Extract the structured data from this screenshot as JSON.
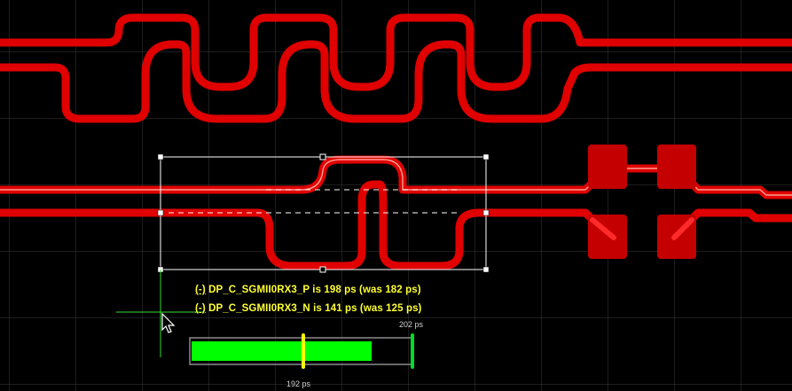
{
  "nets": {
    "p": {
      "prefix": "(-)",
      "text": " DP_C_SGMII0RX3_P is 198 ps (was 182 ps)"
    },
    "n": {
      "prefix": "(-)",
      "text": " DP_C_SGMII0RX3_N is 141 ps (was 125 ps)"
    }
  },
  "gauge": {
    "fill_fraction": 0.86,
    "target_fraction": 0.5,
    "max_label": "202 ps",
    "current_label": "192 ps",
    "colors": {
      "fill": "#00ff00",
      "target": "#ffff00",
      "max_marker": "#00dd22"
    }
  },
  "colors": {
    "trace": "#e00000",
    "pad": "#c40000",
    "grid": "#3a3a3a",
    "selection": "#ffffff",
    "label": "#ffff33"
  },
  "icons": {
    "cursor": "arrow-cursor-icon",
    "crosshair": "crosshair-icon"
  }
}
